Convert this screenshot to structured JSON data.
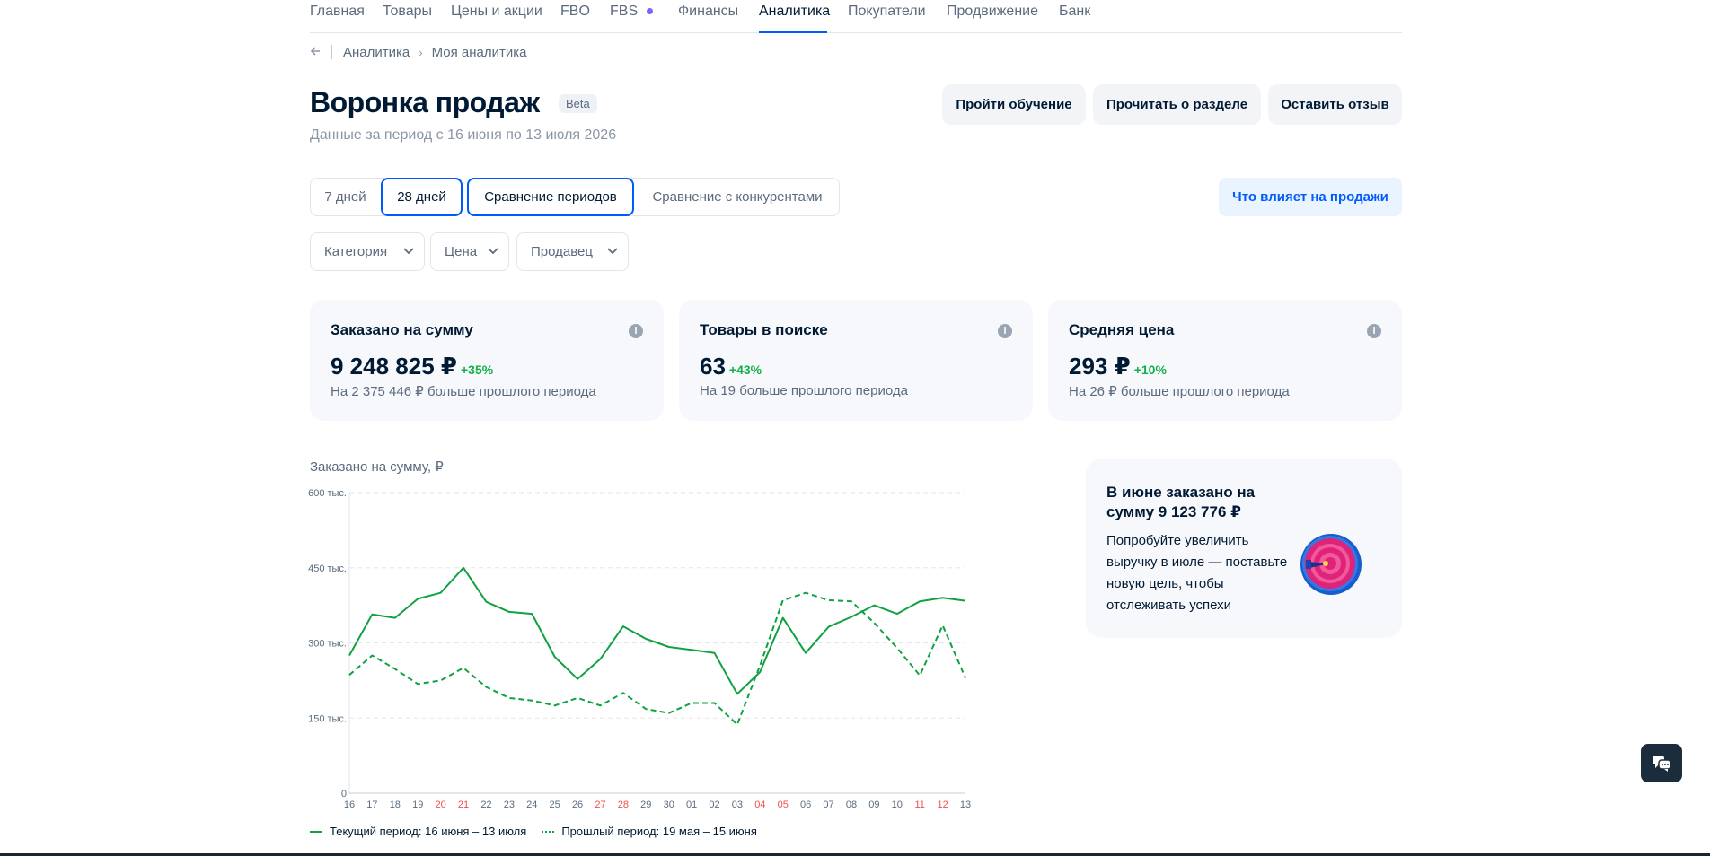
{
  "nav": {
    "items": [
      "Главная",
      "Товары",
      "Цены и акции",
      "FBO",
      "FBS",
      "Финансы",
      "Аналитика",
      "Покупатели",
      "Продвижение",
      "Банк"
    ],
    "active": "Аналитика"
  },
  "breadcrumb": {
    "items": [
      "Аналитика",
      "Моя аналитика"
    ]
  },
  "page": {
    "title": "Воронка продаж",
    "badge": "Beta",
    "subtitle": "Данные за период с 16 июня по 13 июля 2026"
  },
  "header_buttons": {
    "training": "Пройти обучение",
    "read": "Прочитать о разделе",
    "feedback": "Оставить отзыв"
  },
  "period_options": {
    "days7": "7 дней",
    "days28": "28 дней",
    "compare_periods": "Сравнение периодов",
    "compare_competitors": "Сравнение с конкурентами"
  },
  "what_affects": "Что влияет на продажи",
  "filters": {
    "category": "Категория",
    "price": "Цена",
    "seller": "Продавец"
  },
  "cards": [
    {
      "title": "Заказано на сумму",
      "value": "9 248 825 ₽",
      "delta": "+35%",
      "sub": "На 2 375 446 ₽ больше прошлого периода"
    },
    {
      "title": "Товары в поиске",
      "value": "63",
      "delta": "+43%",
      "sub": "На 19 больше прошлого периода"
    },
    {
      "title": "Средняя цена",
      "value": "293 ₽",
      "delta": "+10%",
      "sub": "На 26 ₽ больше прошлого периода"
    }
  ],
  "chart_title": "Заказано на сумму, ₽",
  "chart_data": {
    "type": "line",
    "title": "Заказано на сумму, ₽",
    "x": [
      "16",
      "17",
      "18",
      "19",
      "20",
      "21",
      "22",
      "23",
      "24",
      "25",
      "26",
      "27",
      "28",
      "29",
      "30",
      "01",
      "02",
      "03",
      "04",
      "05",
      "06",
      "07",
      "08",
      "09",
      "10",
      "11",
      "12",
      "13"
    ],
    "weekend_x": [
      "20",
      "21",
      "27",
      "28",
      "04",
      "05",
      "11",
      "12"
    ],
    "y_ticks": [
      "0",
      "150 тыс.",
      "300 тыс.",
      "450 тыс.",
      "600 тыс."
    ],
    "ylim": [
      0,
      600000
    ],
    "grid": true,
    "legend_position": "bottom-left",
    "series": [
      {
        "name": "Текущий период: 16 июня – 13 июля",
        "style": "solid",
        "color": "#10a141",
        "values": [
          275000,
          357000,
          350000,
          388000,
          400000,
          450000,
          382000,
          362000,
          358000,
          272000,
          228000,
          268000,
          333000,
          308000,
          292000,
          286000,
          280000,
          198000,
          242000,
          350000,
          280000,
          332000,
          352000,
          375000,
          358000,
          383000,
          390000,
          384000
        ]
      },
      {
        "name": "Прошлый период: 19 мая – 15 июня",
        "style": "dashed",
        "color": "#10a141",
        "values": [
          236000,
          275000,
          248000,
          218000,
          225000,
          250000,
          212000,
          190000,
          185000,
          175000,
          190000,
          175000,
          200000,
          168000,
          160000,
          180000,
          180000,
          137000,
          255000,
          385000,
          400000,
          385000,
          383000,
          340000,
          290000,
          235000,
          335000,
          230000
        ]
      }
    ]
  },
  "legend": {
    "current": "Текущий период: 16 июня – 13 июля",
    "previous": "Прошлый период: 19 мая – 15 июня"
  },
  "promo": {
    "title": "В июне заказано на сумму 9 123 776 ₽",
    "text": "Попробуйте увеличить выручку в июле — поставьте новую цель, чтобы отслеживать успехи"
  },
  "colors": {
    "accent": "#005bff",
    "positive": "#10b048",
    "line": "#10a141",
    "weekend": "#f0504a"
  }
}
